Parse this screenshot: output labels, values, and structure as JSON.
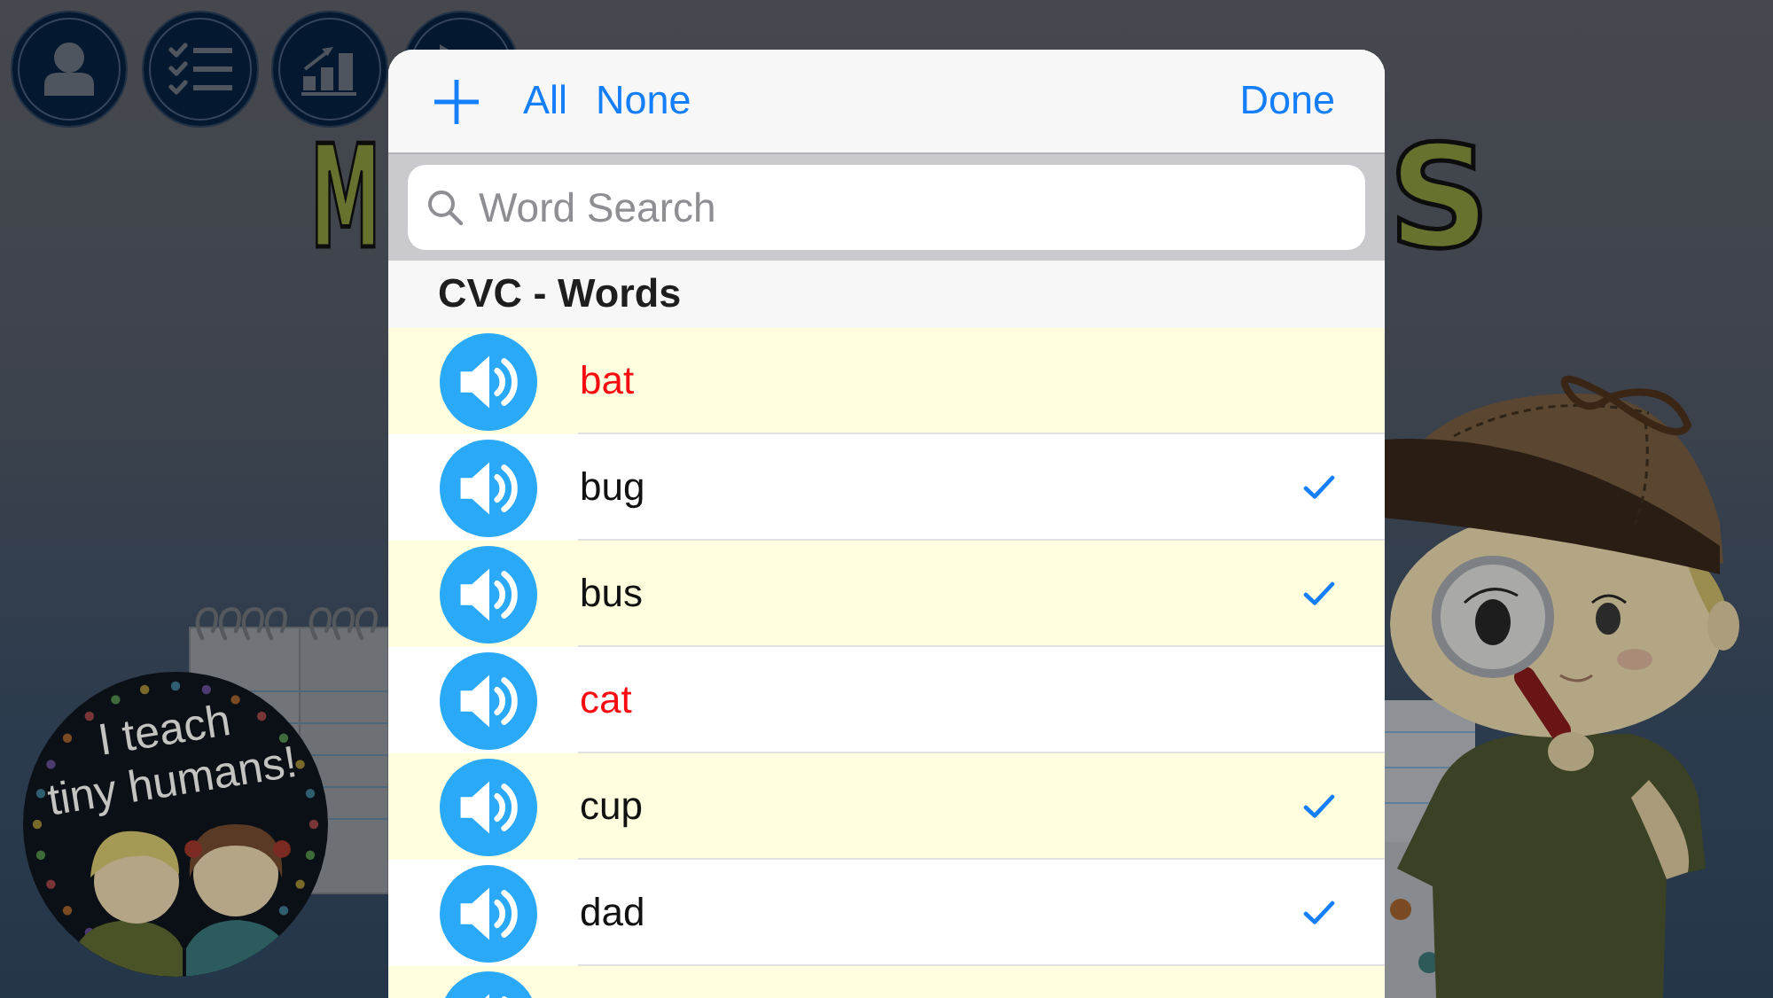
{
  "backdrop": {
    "title_fragments": [
      "M",
      "S"
    ],
    "badge_lines": [
      "I teach",
      "tiny humans!"
    ]
  },
  "picker": {
    "header": {
      "actions": [
        "All",
        "None"
      ],
      "done": "Done"
    },
    "search": {
      "placeholder": "Word Search"
    },
    "section": {
      "title": "CVC - Words",
      "rows": [
        {
          "word": "bat",
          "checked": false
        },
        {
          "word": "bug",
          "checked": true
        },
        {
          "word": "bus",
          "checked": true
        },
        {
          "word": "cat",
          "checked": false
        },
        {
          "word": "cup",
          "checked": true
        },
        {
          "word": "dad",
          "checked": true
        },
        {}
      ]
    }
  }
}
